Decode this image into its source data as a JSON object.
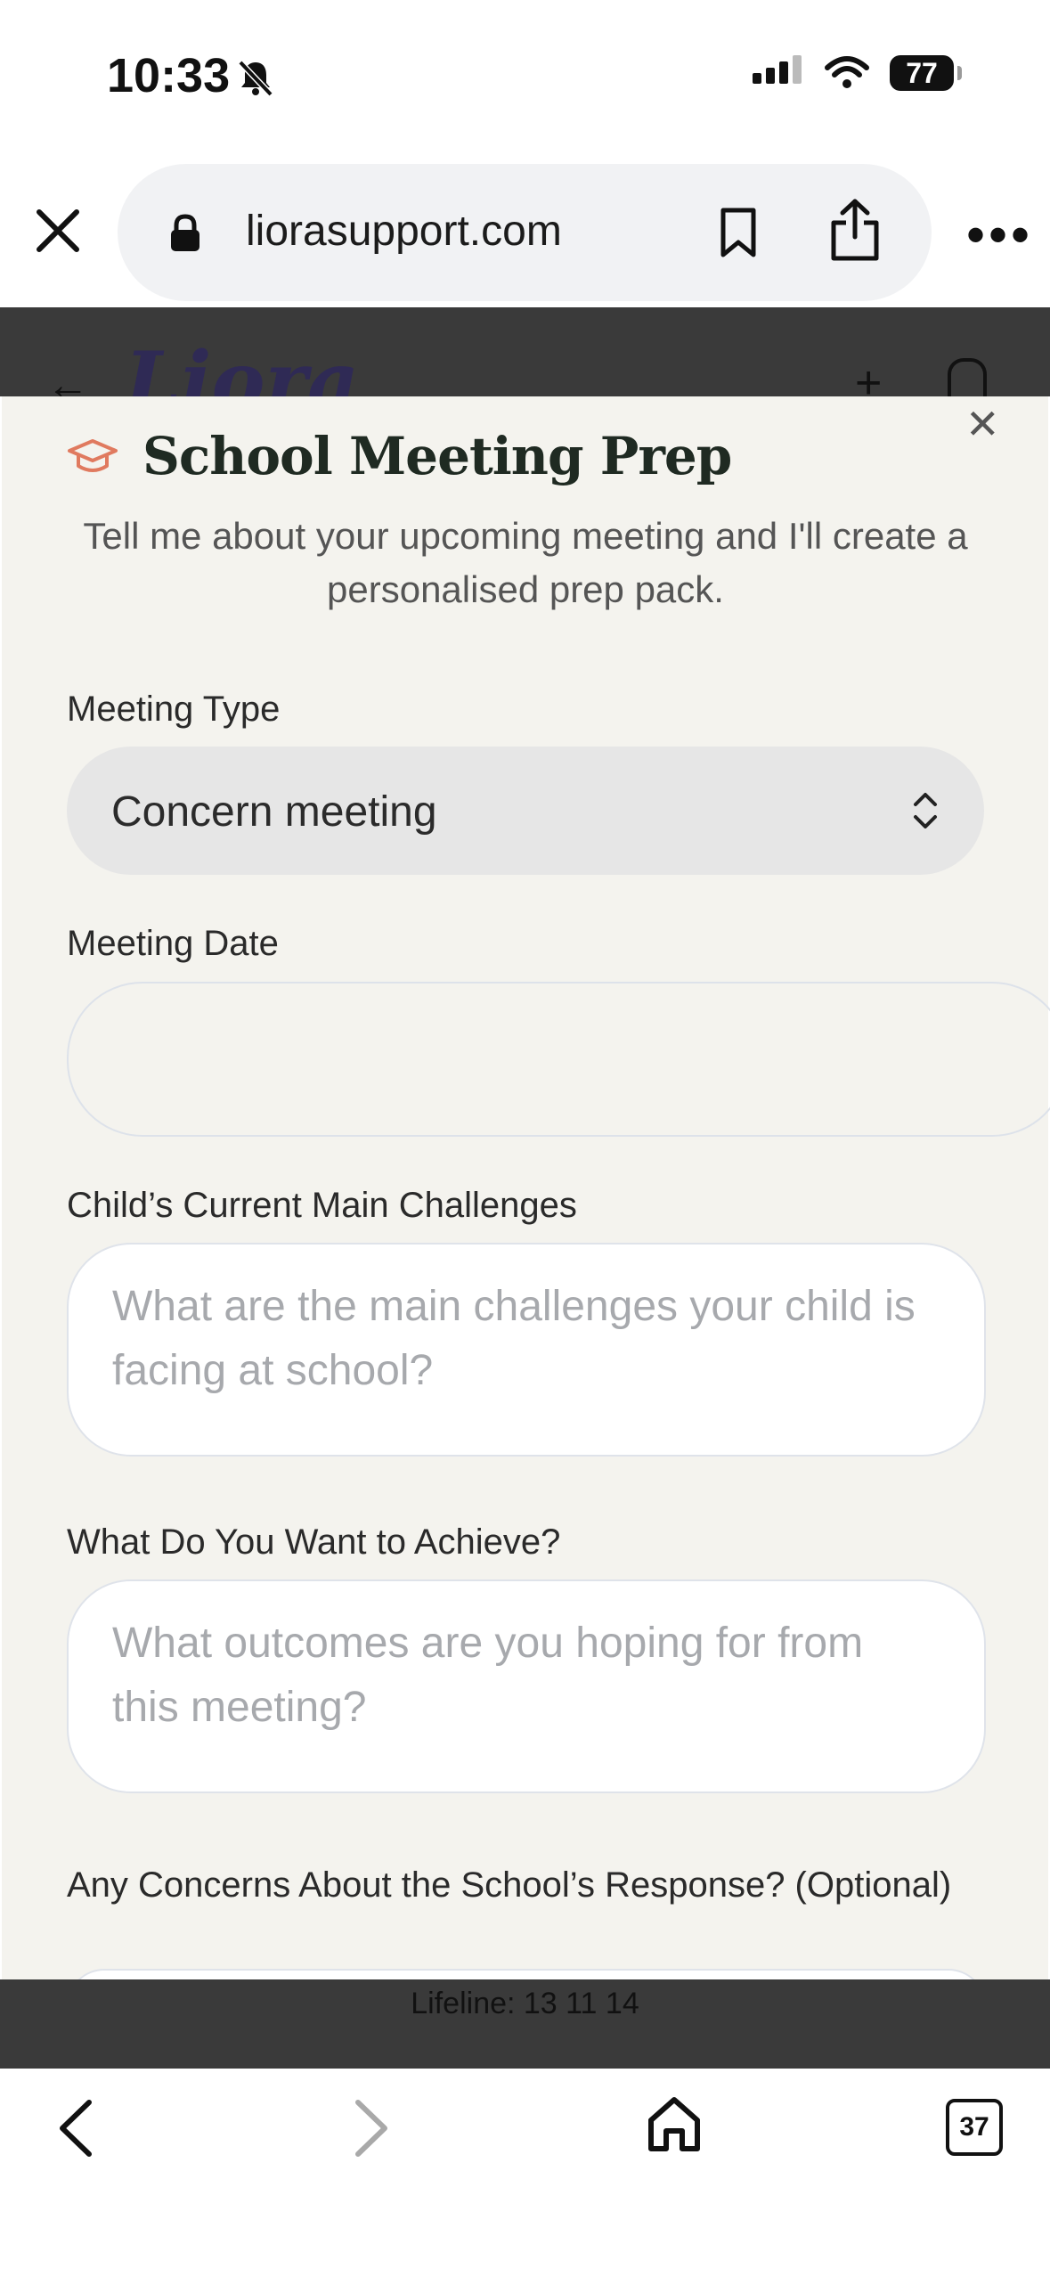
{
  "status_bar": {
    "time": "10:33",
    "battery": "77",
    "icons": [
      "bell-slash-icon",
      "signal-icon",
      "wifi-icon",
      "battery-icon"
    ]
  },
  "browser": {
    "url": "liorasupport.com",
    "icons": [
      "close-icon",
      "lock-icon",
      "bookmark-icon",
      "share-icon",
      "more-icon"
    ]
  },
  "site": {
    "logo": "Liora",
    "icons": [
      "back-arrow-icon",
      "plus-icon",
      "lock-icon"
    ],
    "footer_text": "Lifeline: 13 11 14"
  },
  "modal": {
    "title": "School Meeting Prep",
    "subtitle": "Tell me about your upcoming meeting and I'll create a personalised prep pack.",
    "close_icon": "close-icon",
    "header_icon": "graduation-cap-icon",
    "accent_color": "#e07a5f",
    "fields": {
      "meeting_type": {
        "label": "Meeting Type",
        "value": "Concern meeting"
      },
      "meeting_date": {
        "label": "Meeting Date",
        "value": ""
      },
      "challenges": {
        "label": "Child’s Current Main Challenges",
        "placeholder": "What are the main challenges your child is facing at school?"
      },
      "achieve": {
        "label": "What Do You Want to Achieve?",
        "placeholder": "What outcomes are you hoping for from this meeting?"
      },
      "concerns": {
        "label": "Any Concerns About the School’s Response? (Optional)"
      }
    }
  },
  "toolbar": {
    "tabs_count": "37",
    "icons": [
      "back-icon",
      "forward-icon",
      "home-icon",
      "tabs-icon"
    ]
  }
}
